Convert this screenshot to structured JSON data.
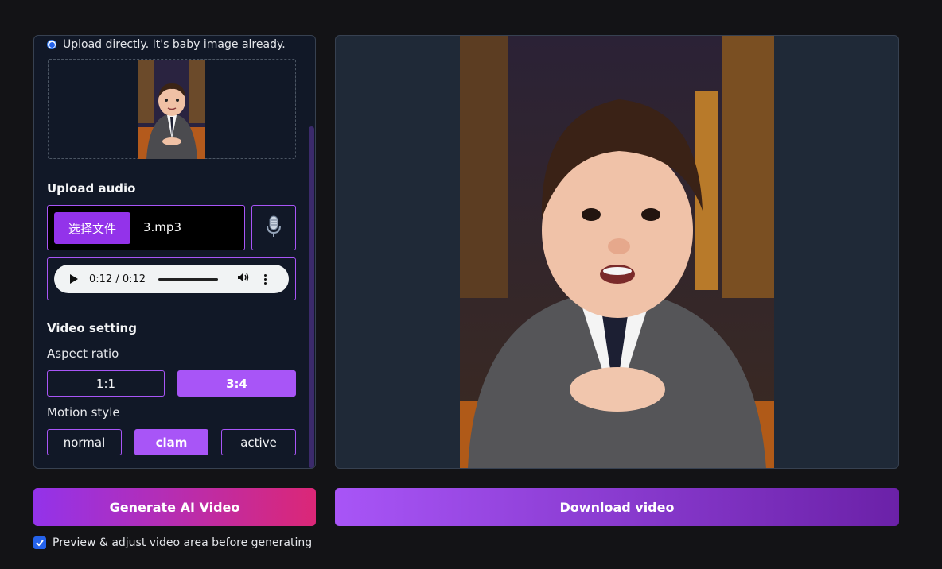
{
  "upload_image": {
    "radio_label": "Upload directly. It's baby image already."
  },
  "audio": {
    "title": "Upload audio",
    "choose_file_label": "选择文件",
    "file_name": "3.mp3",
    "player_time": "0:12 / 0:12"
  },
  "video_setting": {
    "title": "Video setting",
    "aspect_label": "Aspect ratio",
    "aspect_options": [
      "1:1",
      "3:4"
    ],
    "aspect_selected": "3:4",
    "motion_label": "Motion style",
    "motion_options": [
      "normal",
      "clam",
      "active"
    ],
    "motion_selected": "clam"
  },
  "actions": {
    "generate_label": "Generate AI Video",
    "download_label": "Download video"
  },
  "preview_checkbox": {
    "label": "Preview & adjust video area before generating",
    "checked": true
  },
  "colors": {
    "accent": "#a855f7",
    "panel": "#111827",
    "preview_bg": "#1f2937"
  },
  "icons": {
    "mic": "microphone-icon",
    "play": "play-icon",
    "volume": "volume-icon",
    "more": "more-vertical-icon"
  }
}
